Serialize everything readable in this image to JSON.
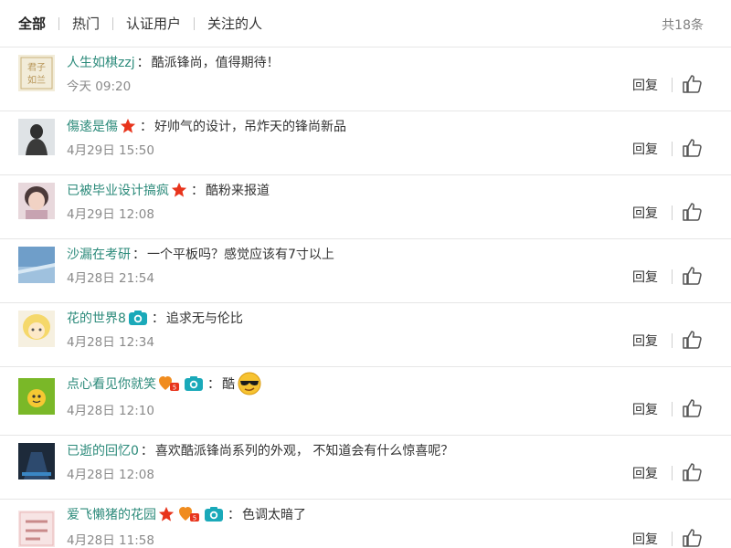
{
  "filter_tabs": [
    {
      "label": "全部",
      "active": true
    },
    {
      "label": "热门",
      "active": false
    },
    {
      "label": "认证用户",
      "active": false
    },
    {
      "label": "关注的人",
      "active": false
    }
  ],
  "total_label": "共18条",
  "reply_label": "回复",
  "colors": {
    "username": "#2b8a7a",
    "time": "#8a8a8a",
    "divider": "#e6e6e6",
    "star": "#e8341c",
    "camera": "#1aa9b9"
  },
  "comments": [
    {
      "username": "人生如棋zzj",
      "badges": [],
      "text": "酷派锋尚，值得期待！",
      "time": "今天 09:20"
    },
    {
      "username": "傷逺是傷",
      "badges": [
        "star-badge-icon"
      ],
      "text": "好帅气的设计，吊炸天的锋尚新品",
      "time": "4月29日 15:50"
    },
    {
      "username": "已被毕业设计搞疯",
      "badges": [
        "star-badge-icon"
      ],
      "text": "酷粉来报道",
      "time": "4月29日 12:08"
    },
    {
      "username": "沙漏在考研",
      "badges": [],
      "text": "一个平板吗？感觉应该有7寸以上",
      "time": "4月28日 21:54"
    },
    {
      "username": "花的世界8",
      "badges": [
        "camera-badge-icon"
      ],
      "text": "追求无与伦比",
      "time": "4月28日 12:34"
    },
    {
      "username": "点心看见你就笑",
      "badges": [
        "heart-badge-icon",
        "camera-badge-icon"
      ],
      "text": "酷",
      "emoji": "cool-sunglasses-emoji-icon",
      "time": "4月28日 12:10"
    },
    {
      "username": "已逝的回忆0",
      "badges": [],
      "text": "喜欢酷派锋尚系列的外观， 不知道会有什么惊喜呢？",
      "time": "4月28日 12:08"
    },
    {
      "username": "爱飞懒猪的花园",
      "badges": [
        "star-badge-icon",
        "heart-badge-icon",
        "camera-badge-icon"
      ],
      "text": "色调太暗了",
      "time": "4月28日 11:58"
    }
  ]
}
